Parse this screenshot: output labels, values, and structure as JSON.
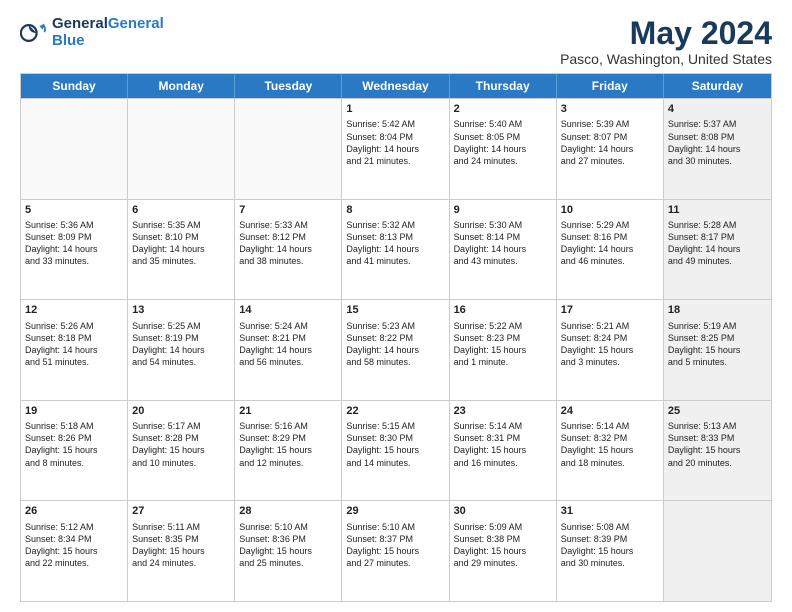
{
  "logo": {
    "line1": "General",
    "line2": "Blue"
  },
  "title": "May 2024",
  "subtitle": "Pasco, Washington, United States",
  "weekdays": [
    "Sunday",
    "Monday",
    "Tuesday",
    "Wednesday",
    "Thursday",
    "Friday",
    "Saturday"
  ],
  "rows": [
    [
      {
        "day": "",
        "text": "",
        "empty": true
      },
      {
        "day": "",
        "text": "",
        "empty": true
      },
      {
        "day": "",
        "text": "",
        "empty": true
      },
      {
        "day": "1",
        "text": "Sunrise: 5:42 AM\nSunset: 8:04 PM\nDaylight: 14 hours\nand 21 minutes."
      },
      {
        "day": "2",
        "text": "Sunrise: 5:40 AM\nSunset: 8:05 PM\nDaylight: 14 hours\nand 24 minutes."
      },
      {
        "day": "3",
        "text": "Sunrise: 5:39 AM\nSunset: 8:07 PM\nDaylight: 14 hours\nand 27 minutes."
      },
      {
        "day": "4",
        "text": "Sunrise: 5:37 AM\nSunset: 8:08 PM\nDaylight: 14 hours\nand 30 minutes.",
        "shaded": true
      }
    ],
    [
      {
        "day": "5",
        "text": "Sunrise: 5:36 AM\nSunset: 8:09 PM\nDaylight: 14 hours\nand 33 minutes."
      },
      {
        "day": "6",
        "text": "Sunrise: 5:35 AM\nSunset: 8:10 PM\nDaylight: 14 hours\nand 35 minutes."
      },
      {
        "day": "7",
        "text": "Sunrise: 5:33 AM\nSunset: 8:12 PM\nDaylight: 14 hours\nand 38 minutes."
      },
      {
        "day": "8",
        "text": "Sunrise: 5:32 AM\nSunset: 8:13 PM\nDaylight: 14 hours\nand 41 minutes."
      },
      {
        "day": "9",
        "text": "Sunrise: 5:30 AM\nSunset: 8:14 PM\nDaylight: 14 hours\nand 43 minutes."
      },
      {
        "day": "10",
        "text": "Sunrise: 5:29 AM\nSunset: 8:16 PM\nDaylight: 14 hours\nand 46 minutes."
      },
      {
        "day": "11",
        "text": "Sunrise: 5:28 AM\nSunset: 8:17 PM\nDaylight: 14 hours\nand 49 minutes.",
        "shaded": true
      }
    ],
    [
      {
        "day": "12",
        "text": "Sunrise: 5:26 AM\nSunset: 8:18 PM\nDaylight: 14 hours\nand 51 minutes."
      },
      {
        "day": "13",
        "text": "Sunrise: 5:25 AM\nSunset: 8:19 PM\nDaylight: 14 hours\nand 54 minutes."
      },
      {
        "day": "14",
        "text": "Sunrise: 5:24 AM\nSunset: 8:21 PM\nDaylight: 14 hours\nand 56 minutes."
      },
      {
        "day": "15",
        "text": "Sunrise: 5:23 AM\nSunset: 8:22 PM\nDaylight: 14 hours\nand 58 minutes."
      },
      {
        "day": "16",
        "text": "Sunrise: 5:22 AM\nSunset: 8:23 PM\nDaylight: 15 hours\nand 1 minute."
      },
      {
        "day": "17",
        "text": "Sunrise: 5:21 AM\nSunset: 8:24 PM\nDaylight: 15 hours\nand 3 minutes."
      },
      {
        "day": "18",
        "text": "Sunrise: 5:19 AM\nSunset: 8:25 PM\nDaylight: 15 hours\nand 5 minutes.",
        "shaded": true
      }
    ],
    [
      {
        "day": "19",
        "text": "Sunrise: 5:18 AM\nSunset: 8:26 PM\nDaylight: 15 hours\nand 8 minutes."
      },
      {
        "day": "20",
        "text": "Sunrise: 5:17 AM\nSunset: 8:28 PM\nDaylight: 15 hours\nand 10 minutes."
      },
      {
        "day": "21",
        "text": "Sunrise: 5:16 AM\nSunset: 8:29 PM\nDaylight: 15 hours\nand 12 minutes."
      },
      {
        "day": "22",
        "text": "Sunrise: 5:15 AM\nSunset: 8:30 PM\nDaylight: 15 hours\nand 14 minutes."
      },
      {
        "day": "23",
        "text": "Sunrise: 5:14 AM\nSunset: 8:31 PM\nDaylight: 15 hours\nand 16 minutes."
      },
      {
        "day": "24",
        "text": "Sunrise: 5:14 AM\nSunset: 8:32 PM\nDaylight: 15 hours\nand 18 minutes."
      },
      {
        "day": "25",
        "text": "Sunrise: 5:13 AM\nSunset: 8:33 PM\nDaylight: 15 hours\nand 20 minutes.",
        "shaded": true
      }
    ],
    [
      {
        "day": "26",
        "text": "Sunrise: 5:12 AM\nSunset: 8:34 PM\nDaylight: 15 hours\nand 22 minutes."
      },
      {
        "day": "27",
        "text": "Sunrise: 5:11 AM\nSunset: 8:35 PM\nDaylight: 15 hours\nand 24 minutes."
      },
      {
        "day": "28",
        "text": "Sunrise: 5:10 AM\nSunset: 8:36 PM\nDaylight: 15 hours\nand 25 minutes."
      },
      {
        "day": "29",
        "text": "Sunrise: 5:10 AM\nSunset: 8:37 PM\nDaylight: 15 hours\nand 27 minutes."
      },
      {
        "day": "30",
        "text": "Sunrise: 5:09 AM\nSunset: 8:38 PM\nDaylight: 15 hours\nand 29 minutes."
      },
      {
        "day": "31",
        "text": "Sunrise: 5:08 AM\nSunset: 8:39 PM\nDaylight: 15 hours\nand 30 minutes."
      },
      {
        "day": "",
        "text": "",
        "empty": true,
        "shaded": true
      }
    ]
  ]
}
